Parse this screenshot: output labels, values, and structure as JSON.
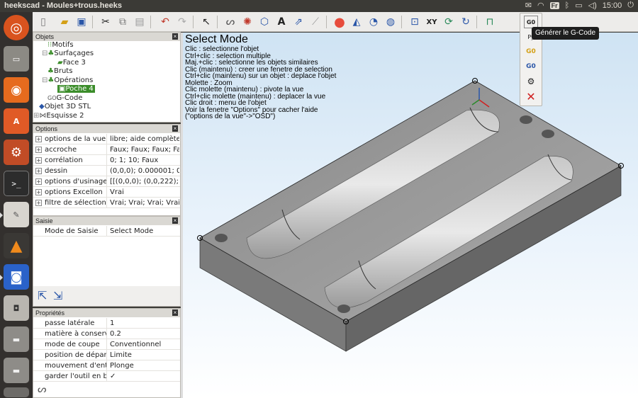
{
  "window": {
    "title": "heekscad - Moules+trous.heeks"
  },
  "tray": {
    "keyboard": "Fr",
    "time": "15:00"
  },
  "objects_panel": {
    "title": "Objets",
    "items": [
      {
        "label": "Motifs",
        "indent": 2,
        "selected": false
      },
      {
        "label": "Surfaçages",
        "indent": 2,
        "selected": false
      },
      {
        "label": "Face 3",
        "indent": 3,
        "selected": false
      },
      {
        "label": "Bruts",
        "indent": 2,
        "selected": false
      },
      {
        "label": "Opérations",
        "indent": 2,
        "selected": false
      },
      {
        "label": "Poche 4",
        "indent": 3,
        "selected": true
      },
      {
        "label": "G-Code",
        "indent": 2,
        "selected": false
      },
      {
        "label": "Objet 3D STL",
        "indent": 1,
        "selected": false
      },
      {
        "label": "Esquisse 2",
        "indent": 1,
        "selected": false
      }
    ]
  },
  "options_panel": {
    "title": "Options",
    "rows": [
      {
        "key": "options de la vue",
        "value": "libre; aide complète;"
      },
      {
        "key": "accroche",
        "value": "Faux; Faux; Faux; Faux"
      },
      {
        "key": "corrélation",
        "value": "0; 1; 10; Faux"
      },
      {
        "key": "dessin",
        "value": "(0,0,0); 0.000001; 0.0"
      },
      {
        "key": "options d'usinage",
        "value": "[[(0,0,0); (0,0,222); (0"
      },
      {
        "key": "options Excellon",
        "value": "Vrai"
      },
      {
        "key": "filtre de sélection",
        "value": "Vrai; Vrai; Vrai; Vrai; V"
      }
    ]
  },
  "input_panel": {
    "title": "Saisie",
    "rows": [
      {
        "key": "Mode de Saisie",
        "value": "Select Mode"
      }
    ]
  },
  "properties_panel": {
    "title": "Propriétés",
    "rows": [
      {
        "key": "passe latérale",
        "value": "1"
      },
      {
        "key": "matière à conserver",
        "value": "0.2"
      },
      {
        "key": "mode de coupe",
        "value": "Conventionnel"
      },
      {
        "key": "position de départ",
        "value": "Limite"
      },
      {
        "key": "mouvement d'entrée",
        "value": "Plonge"
      },
      {
        "key": "garder l'outil en bas",
        "value": "✓"
      }
    ]
  },
  "viewport": {
    "help_title": "Select Mode",
    "help_lines": [
      "Clic : selectionne l'objet",
      "Ctrl+clic : selection multiple",
      "Maj.+clic : selectionne les objets similaires",
      "Clic (maintenu) : creer une fenetre de selection",
      "Ctrl+clic (maintenu) sur un objet : deplace l'objet",
      "Molette : Zoom",
      "Clic molette (maintenu) : pivote la vue",
      "Ctrl+clic molette (maintenu) : deplacer la vue",
      "Clic droit : menu de l'objet",
      "Voir la fenetre \"Options\" pour cacher l'aide",
      "(\"options de la vue\"->\"OSD\")"
    ]
  },
  "tooltip": "Générer le G-Code",
  "colors": {
    "accent_selected": "#3b8d2a",
    "launcher_bg": "#33302e",
    "topbar_bg": "#3b3a36"
  }
}
